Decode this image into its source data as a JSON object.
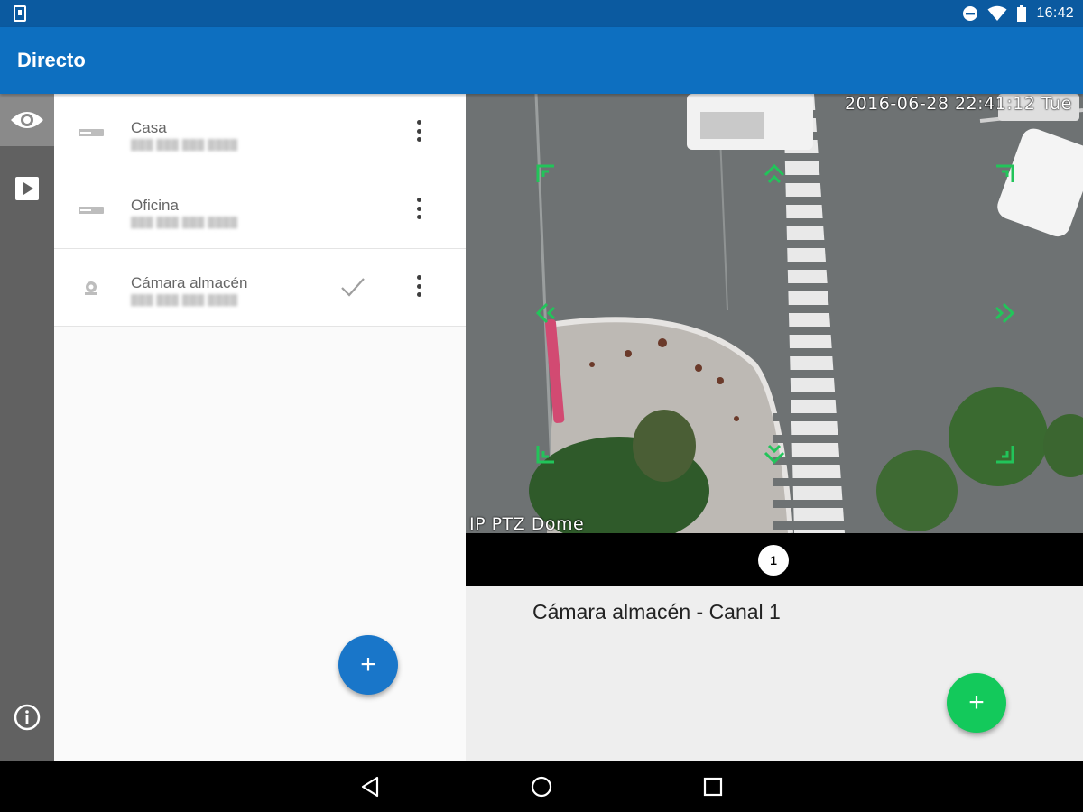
{
  "status_bar": {
    "time": "16:42",
    "icons": [
      "phone-screenshot-icon",
      "do-not-disturb-icon",
      "wifi-icon",
      "battery-icon"
    ]
  },
  "toolbar": {
    "title": "Directo"
  },
  "rail": {
    "items": [
      {
        "name": "live-view",
        "icon": "eye-icon",
        "active": true
      },
      {
        "name": "playback",
        "icon": "play-icon",
        "active": false
      },
      {
        "name": "info",
        "icon": "info-icon",
        "active": false
      }
    ]
  },
  "devices": [
    {
      "name": "Casa",
      "icon": "dvr-icon",
      "selected": false
    },
    {
      "name": "Oficina",
      "icon": "dvr-icon",
      "selected": false
    },
    {
      "name": "Cámara almacén",
      "icon": "camera-icon",
      "selected": true
    }
  ],
  "video": {
    "osd_timestamp": "2016-06-28 22:41:12 Tue",
    "osd_camera_name": "IP PTZ Dome"
  },
  "pager": {
    "current_page": "1"
  },
  "info": {
    "channel_label": "Cámara almacén  - Canal 1"
  },
  "colors": {
    "status_bar": "#0b5aa0",
    "toolbar": "#0d6fc0",
    "rail": "#616161",
    "fab_blue": "#1976c9",
    "fab_green": "#13c95b",
    "ptz_arrows": "#22c45a"
  },
  "fab": {
    "add_label": "+"
  }
}
